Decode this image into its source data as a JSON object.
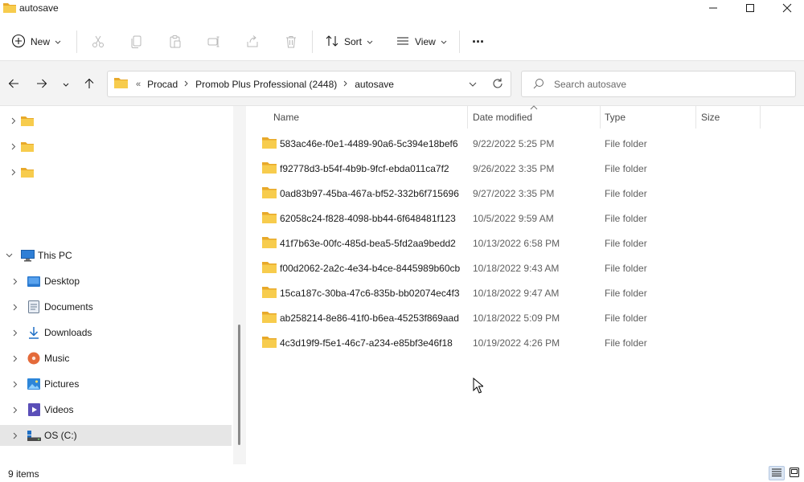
{
  "window": {
    "title": "autosave",
    "icon": "folder-icon"
  },
  "toolbar": {
    "new_label": "New",
    "sort_label": "Sort",
    "view_label": "View",
    "more_label": "···"
  },
  "address": {
    "overflow": "«",
    "crumbs": [
      "Procad",
      "Promob Plus Professional (2448)",
      "autosave"
    ]
  },
  "search": {
    "placeholder": "Search autosave"
  },
  "navpane": {
    "unnamed_items": [
      "",
      "",
      ""
    ],
    "this_pc": "This PC",
    "items": [
      {
        "label": "Desktop",
        "icon": "desktop-icon"
      },
      {
        "label": "Documents",
        "icon": "documents-icon"
      },
      {
        "label": "Downloads",
        "icon": "downloads-icon"
      },
      {
        "label": "Music",
        "icon": "music-icon"
      },
      {
        "label": "Pictures",
        "icon": "pictures-icon"
      },
      {
        "label": "Videos",
        "icon": "videos-icon"
      },
      {
        "label": "OS (C:)",
        "icon": "drive-icon",
        "selected": true
      }
    ]
  },
  "columns": {
    "name": "Name",
    "date": "Date modified",
    "type": "Type",
    "size": "Size"
  },
  "files": [
    {
      "name": "583ac46e-f0e1-4489-90a6-5c394e18bef6",
      "date": "9/22/2022 5:25 PM",
      "type": "File folder"
    },
    {
      "name": "f92778d3-b54f-4b9b-9fcf-ebda011ca7f2",
      "date": "9/26/2022 3:35 PM",
      "type": "File folder"
    },
    {
      "name": "0ad83b97-45ba-467a-bf52-332b6f715696",
      "date": "9/27/2022 3:35 PM",
      "type": "File folder"
    },
    {
      "name": "62058c24-f828-4098-bb44-6f648481f123",
      "date": "10/5/2022 9:59 AM",
      "type": "File folder"
    },
    {
      "name": "41f7b63e-00fc-485d-bea5-5fd2aa9bedd2",
      "date": "10/13/2022 6:58 PM",
      "type": "File folder"
    },
    {
      "name": "f00d2062-2a2c-4e34-b4ce-8445989b60cb",
      "date": "10/18/2022 9:43 AM",
      "type": "File folder"
    },
    {
      "name": "15ca187c-30ba-47c6-835b-bb02074ec4f3",
      "date": "10/18/2022 9:47 AM",
      "type": "File folder"
    },
    {
      "name": "ab258214-8e86-41f0-b6ea-45253f869aad",
      "date": "10/18/2022 5:09 PM",
      "type": "File folder"
    },
    {
      "name": "4c3d19f9-f5e1-46c7-a234-e85bf3e46f18",
      "date": "10/19/2022 4:26 PM",
      "type": "File folder"
    }
  ],
  "status": {
    "count": "9 items"
  },
  "colors": {
    "folder": "#f4c542",
    "accent": "#0067c0"
  }
}
